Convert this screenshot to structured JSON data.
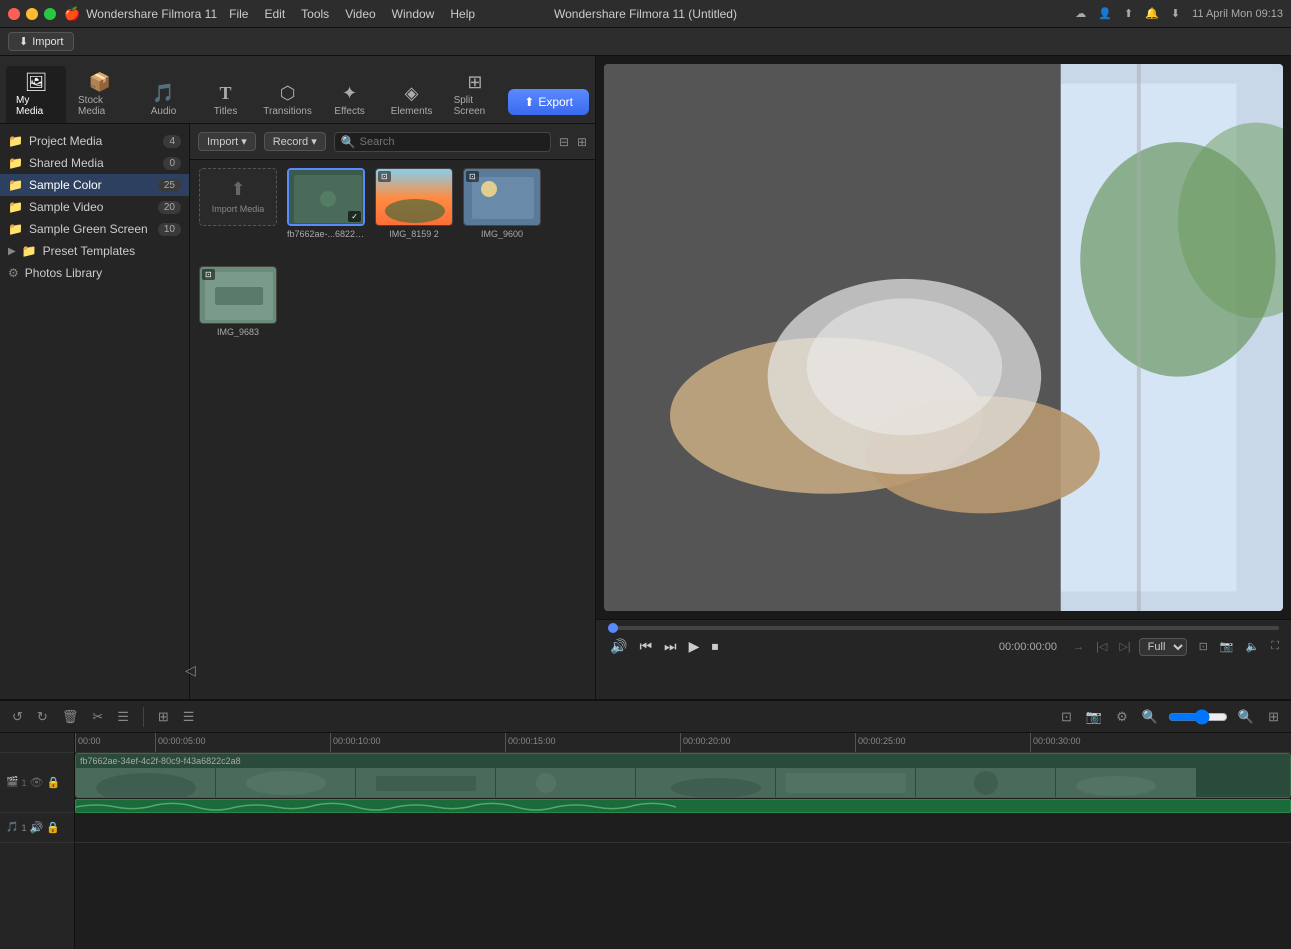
{
  "app": {
    "title": "Wondershare Filmora 11 (Untitled)",
    "name": "Wondershare Filmora 11"
  },
  "titlebar": {
    "date_time": "11 April Mon  09:13",
    "menu": [
      "",
      "Wondershare Filmora 11",
      "File",
      "Edit",
      "Tools",
      "Video",
      "Window",
      "Help"
    ]
  },
  "importbar": {
    "import_label": "Import"
  },
  "toolbar": {
    "tabs": [
      {
        "id": "my-media",
        "icon": "🖼",
        "label": "My Media",
        "active": true
      },
      {
        "id": "stock-media",
        "icon": "📦",
        "label": "Stock Media",
        "active": false
      },
      {
        "id": "audio",
        "icon": "🎵",
        "label": "Audio",
        "active": false
      },
      {
        "id": "titles",
        "icon": "T",
        "label": "Titles",
        "active": false
      },
      {
        "id": "transitions",
        "icon": "⬡",
        "label": "Transitions",
        "active": false
      },
      {
        "id": "effects",
        "icon": "✨",
        "label": "Effects",
        "active": false
      },
      {
        "id": "elements",
        "icon": "🔷",
        "label": "Elements",
        "active": false
      },
      {
        "id": "split-screen",
        "icon": "⊞",
        "label": "Split Screen",
        "active": false
      }
    ],
    "export_label": "Export"
  },
  "sidebar": {
    "items": [
      {
        "id": "project-media",
        "label": "Project Media",
        "count": "4",
        "active": false
      },
      {
        "id": "shared-media",
        "label": "Shared Media",
        "count": "0",
        "active": false
      },
      {
        "id": "sample-color",
        "label": "Sample Color",
        "count": "25",
        "active": true
      },
      {
        "id": "sample-video",
        "label": "Sample Video",
        "count": "20",
        "active": false
      },
      {
        "id": "sample-green-screen",
        "label": "Sample Green Screen",
        "count": "10",
        "active": false
      },
      {
        "id": "preset-templates",
        "label": "Preset Templates",
        "count": "",
        "active": false
      },
      {
        "id": "photos-library",
        "label": "Photos Library",
        "count": "",
        "active": false
      }
    ]
  },
  "content_toolbar": {
    "import_label": "Import",
    "record_label": "Record",
    "search_placeholder": "Search"
  },
  "media_items": [
    {
      "id": "import-media",
      "label": "Import Media",
      "type": "import"
    },
    {
      "id": "fb7662ae",
      "label": "fb7662ae-...6822c2a8",
      "type": "video",
      "thumb": "video"
    },
    {
      "id": "img8159",
      "label": "IMG_8159 2",
      "type": "image",
      "thumb": "sunset"
    },
    {
      "id": "img9600",
      "label": "IMG_9600",
      "type": "image",
      "thumb": "blue"
    },
    {
      "id": "img9683",
      "label": "IMG_9683",
      "type": "image",
      "thumb": "img"
    }
  ],
  "video_controls": {
    "time_current": "00:00:00:00",
    "quality": "Full",
    "play_label": "▶",
    "pause_label": "⏸",
    "stop_label": "⏹",
    "rewind_label": "⏮",
    "ff_label": "⏭",
    "volume_icon": "🔊"
  },
  "timeline": {
    "ruler_marks": [
      "00:00",
      "00:00:05:00",
      "00:00:10:00",
      "00:00:15:00",
      "00:00:20:00",
      "00:00:25:00",
      "00:00:30:00"
    ],
    "video_track_label": "fb7662ae-34ef-4c2f-80c9-f43a6822c2a8",
    "audio_track_num": "1",
    "video_track_num": "1",
    "zoom_level": "100"
  }
}
